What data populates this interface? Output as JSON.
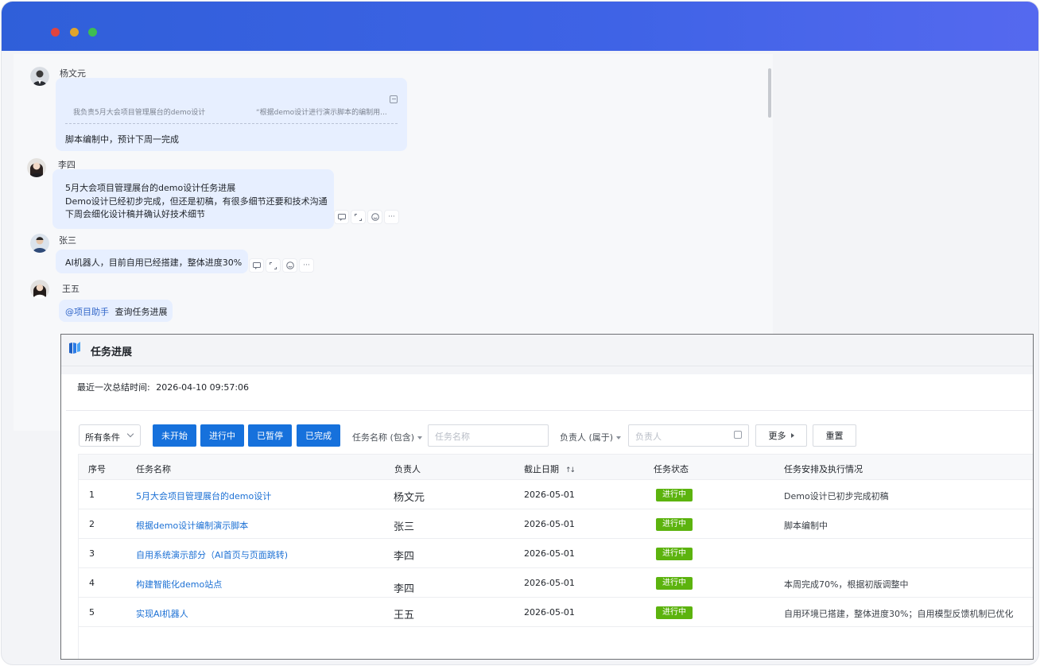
{
  "chat": {
    "messages": [
      {
        "sender": "杨文元",
        "quote_left": "我负责5月大会项目管理展台的demo设计",
        "quote_right": "“根据demo设计进行演示脚本的编制用...",
        "text": "脚本编制中，预计下周一完成"
      },
      {
        "sender": "李四",
        "lines": [
          "5月大会项目管理展台的demo设计任务进展",
          "Demo设计已经初步完成，但还是初稿，有很多细节还要和技术沟通",
          "下周会细化设计稿并确认好技术细节"
        ]
      },
      {
        "sender": "张三",
        "text": "AI机器人，目前自用已经搭建，整体进度30%"
      },
      {
        "sender": "王五",
        "mention": "@项目助手",
        "text": "查询任务进展"
      }
    ],
    "more_icon": "···"
  },
  "panel": {
    "title": "任务进展",
    "summary_label": "最近一次总结时间:",
    "summary_time": "2026-04-10 09:57:06"
  },
  "filters": {
    "all_conditions": "所有条件",
    "status_buttons": [
      "未开始",
      "进行中",
      "已暂停",
      "已完成"
    ],
    "task_name_label": "任务名称 (包含)",
    "task_name_placeholder": "任务名称",
    "owner_label": "负责人 (属于)",
    "owner_placeholder": "负责人",
    "more": "更多",
    "reset": "重置"
  },
  "table": {
    "columns": [
      "序号",
      "任务名称",
      "负责人",
      "截止日期",
      "任务状态",
      "任务安排及执行情况"
    ],
    "sort_icon": "↑↓",
    "rows": [
      {
        "no": "1",
        "name": "5月大会项目管理展台的demo设计",
        "owner": "杨文元",
        "due": "2026-05-01",
        "status": "进行中",
        "notes": "Demo设计已初步完成初稿"
      },
      {
        "no": "2",
        "name": "根据demo设计编制演示脚本",
        "owner": "张三",
        "due": "2026-05-01",
        "status": "进行中",
        "notes": "脚本编制中"
      },
      {
        "no": "3",
        "name": "自用系统演示部分（AI首页与页面跳转)",
        "owner": "李四",
        "due": "2026-05-01",
        "status": "进行中",
        "notes": ""
      },
      {
        "no": "4",
        "name": "构建智能化demo站点",
        "owner": "李四",
        "due": "2026-05-01",
        "status": "进行中",
        "notes": "本周完成70%，根据初版调整中"
      },
      {
        "no": "5",
        "name": "实现AI机器人",
        "owner": "王五",
        "due": "2026-05-01",
        "status": "进行中",
        "notes": "自用环境已搭建，整体进度30%；自用模型反馈机制已优化"
      }
    ]
  },
  "colors": {
    "titlebar": "#3f63e6",
    "bubble": "#e7efff",
    "primary_button": "#1671dc",
    "status_in_progress": "#5cb30e",
    "link": "#1a6fd4"
  },
  "icons": [
    "avatar",
    "quote-open-icon",
    "reply-icon",
    "expand-icon",
    "emoji-icon",
    "more-icon",
    "panel-logo-icon",
    "chevron-down-icon",
    "sort-icon",
    "owner-picker-icon",
    "caret-right-icon"
  ]
}
